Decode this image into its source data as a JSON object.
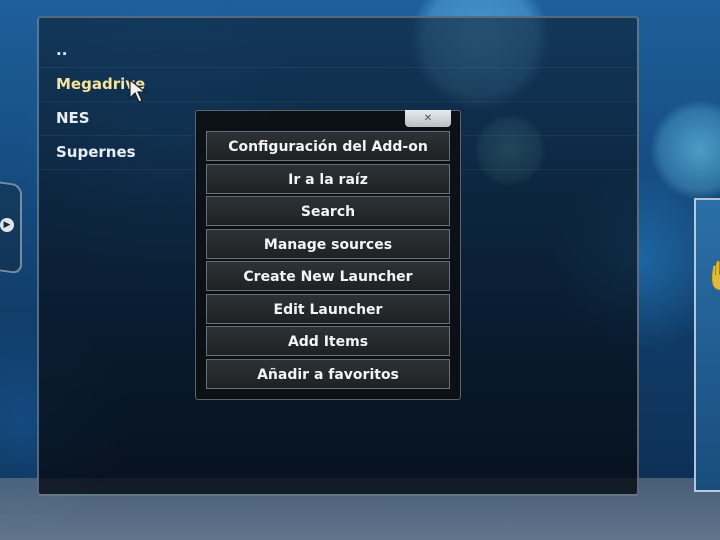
{
  "browser": {
    "items": [
      {
        "label": ".."
      },
      {
        "label": "Megadrive"
      },
      {
        "label": "NES"
      },
      {
        "label": "Supernes"
      }
    ]
  },
  "context_menu": {
    "close_label": "✕",
    "items": [
      {
        "label": "Configuración del Add-on"
      },
      {
        "label": "Ir a la raíz"
      },
      {
        "label": "Search"
      },
      {
        "label": "Manage sources"
      },
      {
        "label": "Create New Launcher"
      },
      {
        "label": "Edit Launcher"
      },
      {
        "label": "Add Items"
      },
      {
        "label": "Añadir a favoritos"
      }
    ]
  },
  "colors": {
    "focused_text": "#f6e59a",
    "menu_bg": "#1e2124"
  }
}
